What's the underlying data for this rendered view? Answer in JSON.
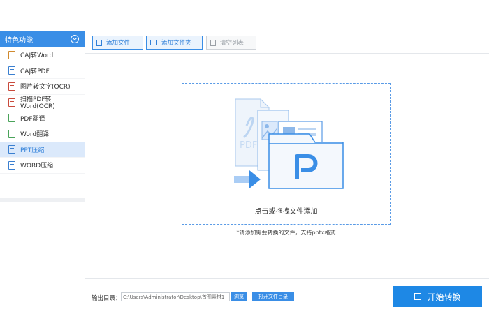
{
  "sidebar": {
    "title": "特色功能",
    "items": [
      {
        "label": "CAJ转Word",
        "color": "#d08a2e"
      },
      {
        "label": "CAJ转PDF",
        "color": "#3a7fd0"
      },
      {
        "label": "图片转文字(OCR)",
        "color": "#c94a3c"
      },
      {
        "label": "扫描PDF转Word(OCR)",
        "color": "#c94a3c"
      },
      {
        "label": "PDF翻译",
        "color": "#4aa35a"
      },
      {
        "label": "Word翻译",
        "color": "#4aa35a"
      },
      {
        "label": "PPT压缩",
        "color": "#3a7fd0",
        "active": true
      },
      {
        "label": "WORD压缩",
        "color": "#3a7fd0"
      }
    ]
  },
  "toolbar": {
    "add_file": "添加文件",
    "add_folder": "添加文件夹",
    "clear_list": "清空列表"
  },
  "dropzone": {
    "text": "点击或拖拽文件添加",
    "hint": "*请添加需要转换的文件，支持pptx格式"
  },
  "footer": {
    "output_label": "输出目录：",
    "output_path": "C:\\Users\\Administrator\\Desktop\\首图素材1",
    "browse": "浏览",
    "open_folder": "打开文件目录",
    "start": "开始转换"
  },
  "colors": {
    "accent": "#3a8ee6",
    "active_bg": "#dbe9fb"
  }
}
